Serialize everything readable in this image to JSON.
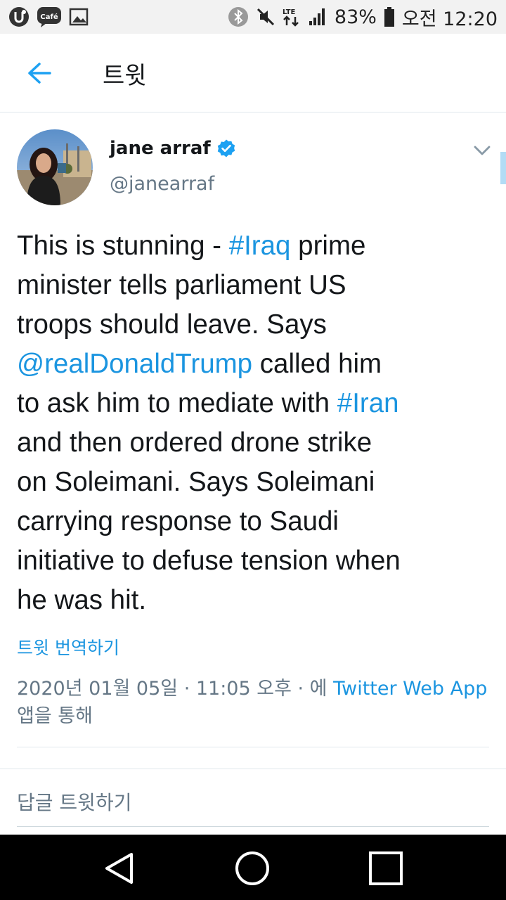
{
  "status_bar": {
    "cafe_label": "Café",
    "battery": "83%",
    "lte": "LTE",
    "time": "오전 12:20",
    "icons": [
      "app-u-icon",
      "cafe-chat-icon",
      "gallery-icon",
      "bluetooth-icon",
      "mute-icon",
      "lte-data-icon",
      "signal-icon",
      "battery-icon"
    ]
  },
  "header": {
    "title": "트윗",
    "back_icon": "back-arrow-icon"
  },
  "tweet": {
    "author_name": "jane arraf",
    "handle": "@janearraf",
    "verified_icon": "verified-badge-icon",
    "more_icon": "chevron-down-icon",
    "text_lines": [
      [
        "This is stunning - ",
        "#Iraq",
        " prime"
      ],
      [
        "minister tells parliament US"
      ],
      [
        "troops should leave. Says"
      ],
      [
        "@realDonaldTrump",
        " called him"
      ],
      [
        "to ask him to mediate with ",
        "#Iran"
      ],
      [
        "and then ordered drone strike"
      ],
      [
        "on Soleimani. Says Soleimani"
      ],
      [
        "carrying response to Saudi"
      ],
      [
        "initiative to defuse tension when"
      ],
      [
        "he was hit."
      ]
    ],
    "translate_label": "트윗 번역하기",
    "meta_date": "2020년 01월 05일 · 11:05 오후 · 에 ",
    "meta_app": "Twitter Web App",
    "meta_suffix": "앱을 통해"
  },
  "reply": {
    "placeholder": "답글 트윗하기"
  },
  "colors": {
    "link": "#1b95e0",
    "text": "#14171a",
    "muted": "#657786",
    "status_bar_bg": "#f2f2f2",
    "nav_bar_bg": "#000000"
  },
  "nav_bar": {
    "icons": [
      "back-triangle-icon",
      "home-circle-icon",
      "recents-square-icon"
    ]
  }
}
